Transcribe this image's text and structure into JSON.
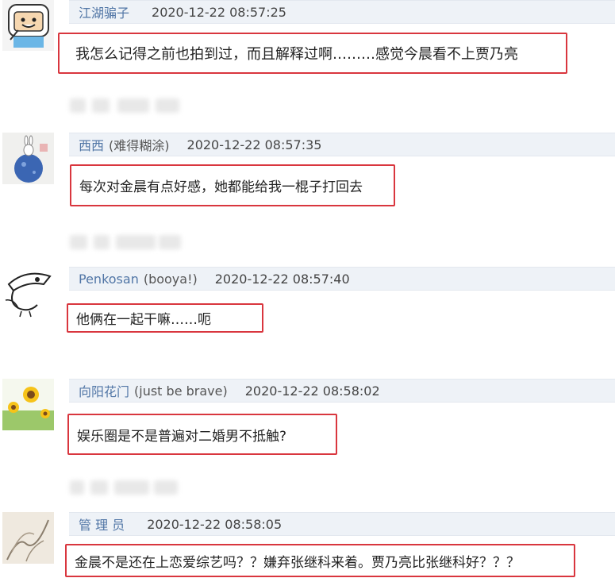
{
  "comments": [
    {
      "author": "江湖骗子",
      "tag": "",
      "time": "2020-12-22 08:57:25",
      "text": "我怎么记得之前也拍到过，而且解释过啊………感觉今晨看不上贾乃亮",
      "avatar": "adventure-time-avatar"
    },
    {
      "author": "西西",
      "tag": "(难得糊涂)",
      "time": "2020-12-22 08:57:35",
      "text": "每次对金晨有点好感，她都能给我一棍子打回去",
      "avatar": "rabbit-globe-avatar"
    },
    {
      "author": "Penkosan",
      "tag": "(booya!)",
      "time": "2020-12-22 08:57:40",
      "text": "他俩在一起干嘛……呃",
      "avatar": "sketch-bird-avatar"
    },
    {
      "author": "向阳花门",
      "tag": "(just be brave)",
      "time": "2020-12-22 08:58:02",
      "text": "娱乐圈是不是普遍对二婚男不抵触?",
      "avatar": "sunflower-avatar"
    },
    {
      "author": "管 理 员",
      "tag": "",
      "time": "2020-12-22 08:58:05",
      "text": "金晨不是还在上恋爱综艺吗？？嫌弃张继科来着。贾乃亮比张继科好？？？",
      "avatar": "ink-painting-avatar"
    }
  ],
  "colors": {
    "highlight": "#d9363e",
    "author": "#5176a6",
    "meta_bg": "#eef2f7"
  }
}
